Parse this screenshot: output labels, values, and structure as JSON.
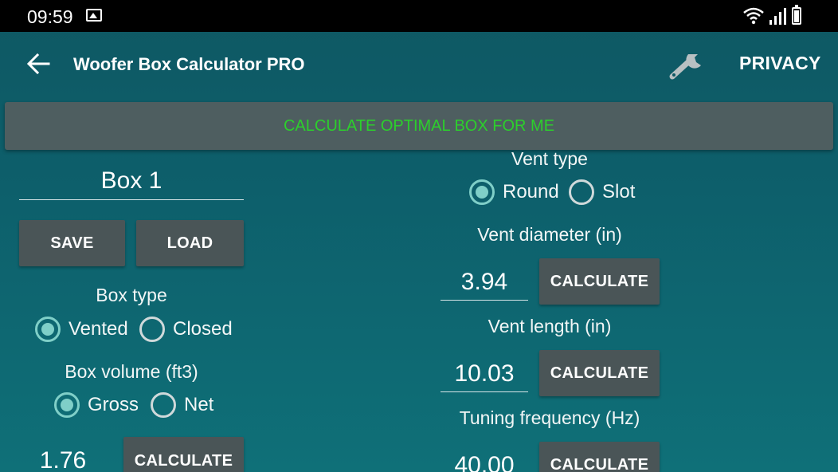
{
  "status_bar": {
    "time": "09:59"
  },
  "app_bar": {
    "title": "Woofer Box Calculator PRO",
    "privacy_label": "PRIVACY"
  },
  "optimal_button": {
    "label": "CALCULATE OPTIMAL BOX FOR ME"
  },
  "left_panel": {
    "box_name": "Box 1",
    "save_label": "SAVE",
    "load_label": "LOAD",
    "box_type_label": "Box type",
    "box_type_options": [
      "Vented",
      "Closed"
    ],
    "box_type_selected": "Vented",
    "box_volume_label": "Box volume  (ft3)",
    "volume_mode_options": [
      "Gross",
      "Net"
    ],
    "volume_mode_selected": "Gross",
    "box_volume_value": "1.76",
    "calculate_label": "CALCULATE"
  },
  "right_panel": {
    "vent_type_label": "Vent type",
    "vent_type_options": [
      "Round",
      "Slot"
    ],
    "vent_type_selected": "Round",
    "vent_diameter_label": "Vent diameter  (in)",
    "vent_diameter_value": "3.94",
    "vent_length_label": "Vent length  (in)",
    "vent_length_value": "10.03",
    "tuning_frequency_label": "Tuning frequency (Hz)",
    "tuning_frequency_value": "40.00",
    "calculate_label": "CALCULATE"
  },
  "colors": {
    "accent_green": "#2ccf2c",
    "radio_accent": "#7fcfc8",
    "button_bg": "#4a5557"
  }
}
